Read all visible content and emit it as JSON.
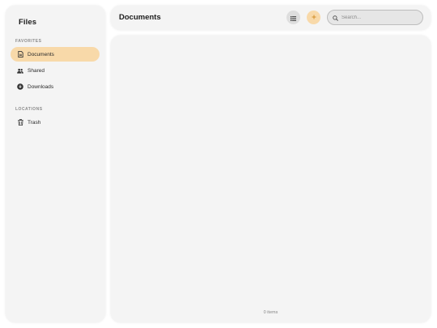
{
  "sidebar": {
    "title": "Files",
    "favorites_label": "FAVORITES",
    "locations_label": "LOCATIONS",
    "favorites": [
      {
        "label": "Documents",
        "icon": "document-icon",
        "active": true
      },
      {
        "label": "Shared",
        "icon": "people-icon",
        "active": false
      },
      {
        "label": "Downloads",
        "icon": "download-icon",
        "active": false
      }
    ],
    "locations": [
      {
        "label": "Trash",
        "icon": "trash-icon",
        "active": false
      }
    ]
  },
  "header": {
    "title": "Documents",
    "view_icon": "grid-view-icon",
    "add_icon": "plus-icon",
    "search_placeholder": "Search...",
    "search_value": ""
  },
  "main": {
    "item_count": "0 items"
  },
  "colors": {
    "accent": "#f8d9a9",
    "accent_text": "#d08a20",
    "panel": "#f4f4f4",
    "page": "#ffffff"
  }
}
